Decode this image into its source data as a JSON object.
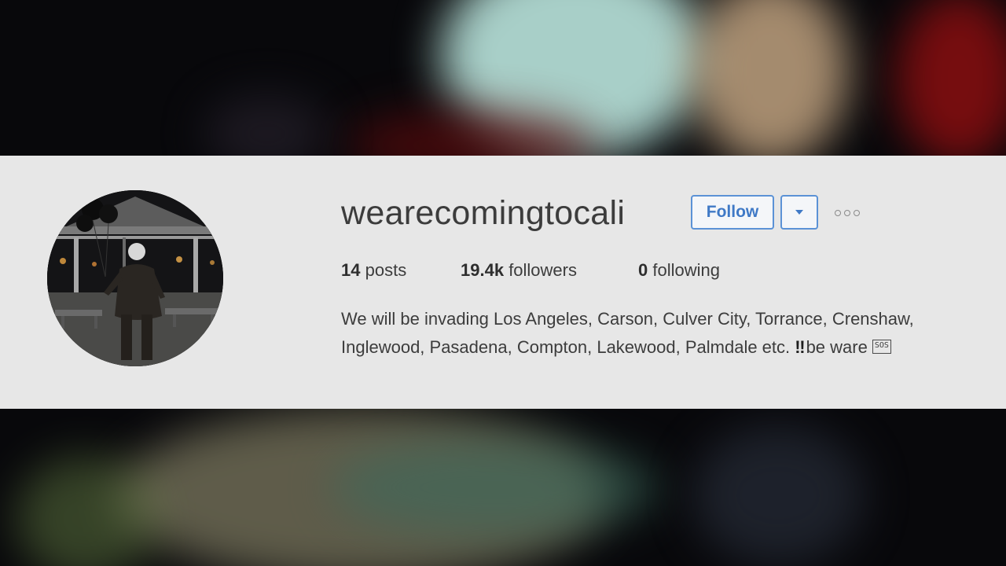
{
  "profile": {
    "username": "wearecomingtocali",
    "follow_label": "Follow",
    "dropdown_icon": "caret-down-icon",
    "more_icon": "more-options-icon",
    "stats": {
      "posts_count": "14",
      "posts_label": "posts",
      "followers_count": "19.4k",
      "followers_label": "followers",
      "following_count": "0",
      "following_label": "following"
    },
    "bio": {
      "line1": "We will be invading Los Angeles, Carson, Culver City, Torrance, Crenshaw,",
      "line2": "Inglewood, Pasadena, Compton, Lakewood, Palmdale etc.",
      "exclamation": "‼",
      "ending": "be ware",
      "sos_emoji": "SOS"
    }
  },
  "colors": {
    "panel": "#e7e7e7",
    "accent_blue": "#3f79c6",
    "text": "#3c3c3c"
  }
}
